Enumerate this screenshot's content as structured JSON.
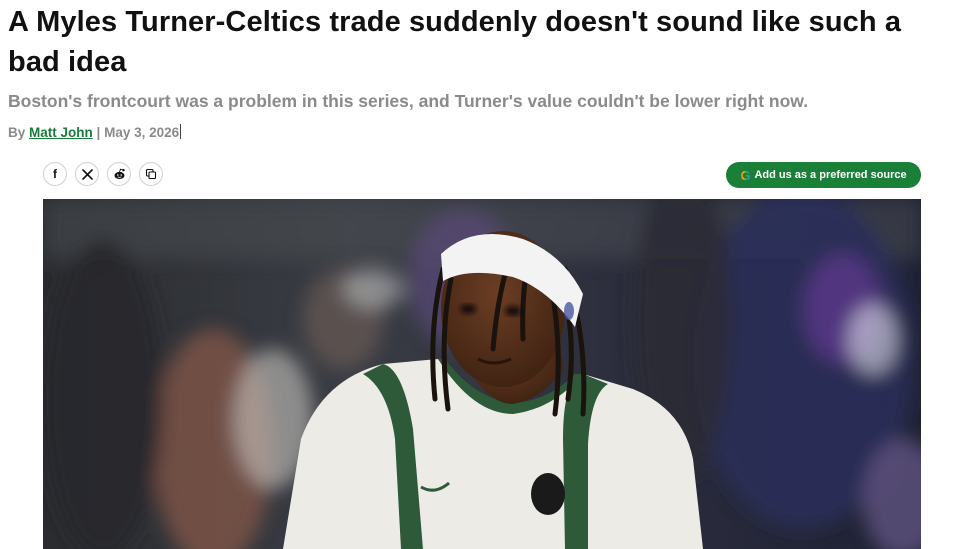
{
  "article": {
    "headline": "A Myles Turner-Celtics trade suddenly doesn't sound like such a bad idea",
    "subheadline": "Boston's frontcourt was a problem in this series, and Turner's value couldn't be lower right now.",
    "byline_prefix": "By",
    "author": "Matt John",
    "separator": "|",
    "date": "May 3, 2026"
  },
  "share": {
    "icons": [
      "facebook-icon",
      "x-icon",
      "reddit-icon",
      "copy-link-icon"
    ],
    "facebook_glyph": "f",
    "x_glyph": "𝕏"
  },
  "preferred_source": {
    "icon": "google-icon",
    "icon_glyph": "G",
    "label": "Add us as a preferred source"
  },
  "colors": {
    "author_link": "#1a7a3a",
    "preferred_button": "#1a7f37",
    "headline": "#111111",
    "muted_text": "#8a8a8a",
    "jersey_green": "#2e5a3a"
  },
  "hero_image": {
    "subject": "basketball-player-photo"
  }
}
